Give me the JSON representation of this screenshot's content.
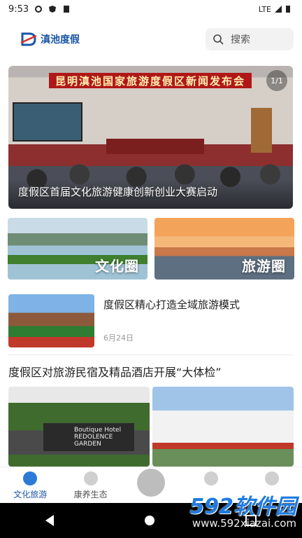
{
  "status_bar": {
    "time": "9:53",
    "network": "LTE"
  },
  "header": {
    "logo_text": "滇池度假",
    "search_placeholder": "搜索"
  },
  "banner": {
    "sign_text": "昆明滇池国家旅游度假区新闻发布会",
    "counter": "1/1",
    "caption": "度假区首届文化旅游健康创新创业大赛启动"
  },
  "tiles": [
    {
      "label": "文化圈"
    },
    {
      "label": "旅游圈"
    }
  ],
  "news": {
    "title": "度假区精心打造全域旅游模式",
    "date": "6月24日"
  },
  "article": {
    "title": "度假区对旅游民宿及精品酒店开展“大体检”",
    "garden_sign_line1": "Boutique Hotel",
    "garden_sign_line2": "REDOLENCE",
    "garden_sign_line3": "GARDEN"
  },
  "bottom_nav": [
    {
      "label": "文化旅游",
      "active": true
    },
    {
      "label": "康养生态",
      "active": false
    },
    {
      "label": "",
      "active": false
    },
    {
      "label": "",
      "active": false
    },
    {
      "label": "",
      "active": false
    }
  ],
  "watermark": {
    "brand": "592软件园",
    "url": "www.592xiazai.com"
  },
  "colors": {
    "accent": "#1b56a6",
    "nav_active": "#2b7ad8"
  }
}
